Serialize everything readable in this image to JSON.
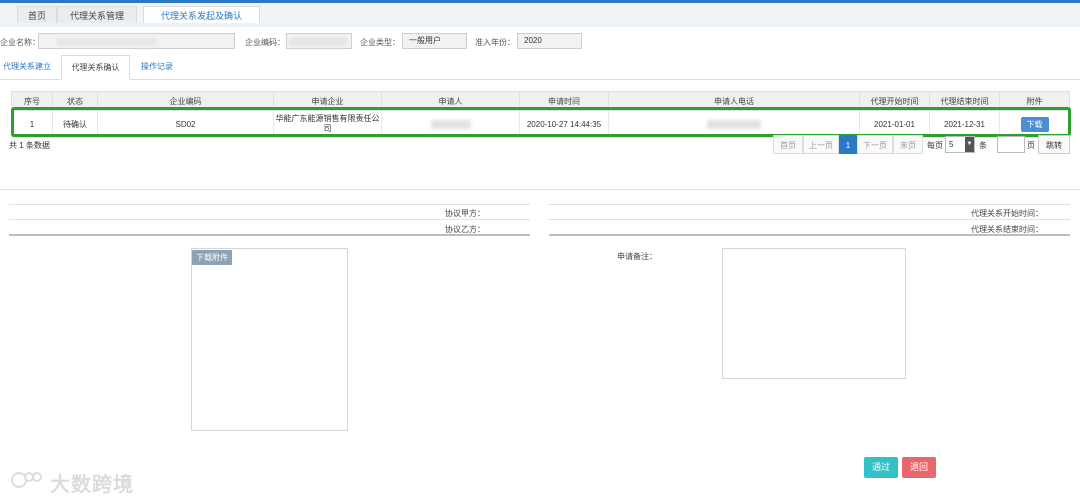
{
  "tabs": [
    {
      "label": "首页"
    },
    {
      "label": "代理关系管理"
    },
    {
      "label": "代理关系发起及确认"
    }
  ],
  "form": {
    "company_name_label": "企业名称：",
    "company_code_label": "企业编码：",
    "company_type_label": "企业类型：",
    "company_type_value": "一般用户",
    "year_label": "准入年份：",
    "year_value": "2020"
  },
  "subtabs": [
    {
      "label": "代理关系建立"
    },
    {
      "label": "代理关系确认"
    },
    {
      "label": "操作记录"
    }
  ],
  "table": {
    "headers": [
      "序号",
      "状态",
      "企业编码",
      "申请企业",
      "申请人",
      "申请时间",
      "申请人电话",
      "代理开始时间",
      "代理结束时间",
      "附件"
    ],
    "rows": [
      {
        "index": "1",
        "status": "待确认",
        "code": "SD02",
        "company": "华能广东能源销售有限责任公司",
        "time": "2020-10-27 14:44:35",
        "start": "2021-01-01",
        "end": "2021-12-31",
        "attachment_btn": "下载"
      }
    ]
  },
  "pagination": {
    "total": "共 1 条数据",
    "first": "首页",
    "prev": "上一页",
    "current": "1",
    "next": "下一页",
    "last": "末页",
    "per_page_label": "每页",
    "per_page_value": "5",
    "per_page_unit": "条",
    "page_unit": "页",
    "jump": "跳转"
  },
  "detail": {
    "party_a_label": "协议甲方：",
    "party_b_label": "协议乙方：",
    "start_label": "代理关系开始时间：",
    "end_label": "代理关系结束时间：",
    "download_attachment": "下载附件",
    "remark_label": "申请备注："
  },
  "actions": {
    "pass": "通过",
    "back": "退回"
  },
  "watermark": "大数跨境",
  "colors": {
    "accent": "#2b78c5",
    "highlight": "#2ca02c",
    "pass": "#33c1c8",
    "back": "#e8676f"
  }
}
